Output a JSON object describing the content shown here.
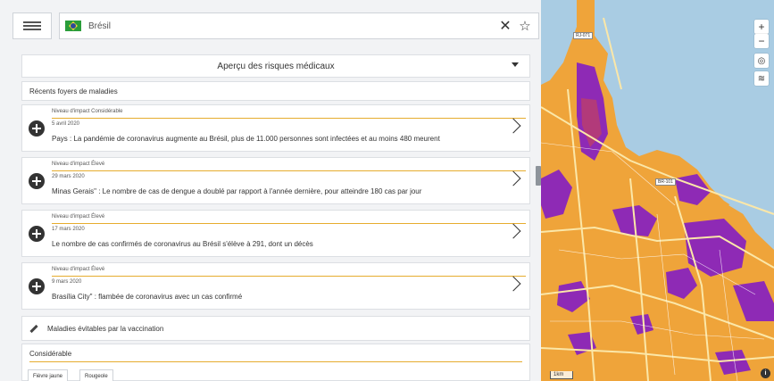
{
  "search": {
    "country": "Brésil"
  },
  "risk_header": {
    "title": "Aperçu des risques médicaux"
  },
  "outbreaks": {
    "title": "Récents foyers de maladies",
    "items": [
      {
        "impact": "Niveau d'impact Considérable",
        "date": "5 avril 2020",
        "text": "Pays : La pandémie de coronavirus augmente au Brésil, plus de 11.000 personnes sont infectées et au moins 480 meurent"
      },
      {
        "impact": "Niveau d'impact Élevé",
        "date": "29 mars 2020",
        "text": "Minas Gerais\" : Le nombre de cas de dengue a doublé par rapport à l'année dernière, pour atteindre 180 cas par jour"
      },
      {
        "impact": "Niveau d'impact Élevé",
        "date": "17 mars 2020",
        "text": "Le nombre de cas confirmés de coronavirus au Brésil s'élève à 291, dont un décès"
      },
      {
        "impact": "Niveau d'impact Élevé",
        "date": "9 mars 2020",
        "text": "Brasília City\" : flambée de coronavirus avec un cas confirmé"
      }
    ]
  },
  "vaccination": {
    "title": "Maladies évitables par la vaccination"
  },
  "considerable": {
    "label": "Considérable",
    "chips": [
      "Fièvre jaune",
      "Rougeole"
    ]
  },
  "map": {
    "roads": [
      "RJ-071",
      "BR-101"
    ],
    "scale": "1km",
    "colors": {
      "water": "#a9cce3",
      "land": "#efa43a",
      "purple": "#8e2ab5",
      "magenta": "#b23a7a",
      "road": "#fbe7a8"
    }
  }
}
